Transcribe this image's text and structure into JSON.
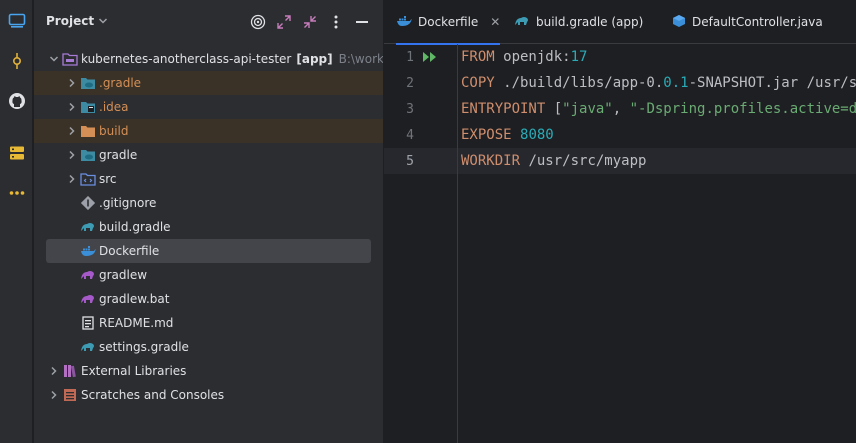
{
  "project_panel": {
    "title": "Project",
    "root": {
      "name": "kubernetes-anotherclass-api-tester",
      "module": "[app]",
      "path": "B:\\workspace"
    },
    "items": [
      {
        "label": ".gradle",
        "icon": "folder-gradle-icon",
        "expandable": true,
        "ignored": true
      },
      {
        "label": ".idea",
        "icon": "folder-idea-icon",
        "expandable": true,
        "ignored": false
      },
      {
        "label": "build",
        "icon": "folder-excluded-icon",
        "expandable": true,
        "ignored": true
      },
      {
        "label": "gradle",
        "icon": "folder-gradle-icon",
        "expandable": true,
        "ignored": false
      },
      {
        "label": "src",
        "icon": "folder-source-icon",
        "expandable": true,
        "ignored": false
      },
      {
        "label": ".gitignore",
        "icon": "gitignore-icon",
        "expandable": false
      },
      {
        "label": "build.gradle",
        "icon": "gradle-file-icon",
        "expandable": false
      },
      {
        "label": "Dockerfile",
        "icon": "docker-icon",
        "expandable": false,
        "selected": true
      },
      {
        "label": "gradlew",
        "icon": "gradlew-icon",
        "expandable": false
      },
      {
        "label": "gradlew.bat",
        "icon": "gradlew-icon",
        "expandable": false
      },
      {
        "label": "README.md",
        "icon": "markdown-icon",
        "expandable": false
      },
      {
        "label": "settings.gradle",
        "icon": "gradle-file-icon",
        "expandable": false
      }
    ],
    "external_libraries": "External Libraries",
    "scratches": "Scratches and Consoles"
  },
  "tabs": [
    {
      "label": "Dockerfile",
      "active": true
    },
    {
      "label": "build.gradle (app)",
      "active": false
    },
    {
      "label": "DefaultController.java",
      "active": false
    }
  ],
  "editor": {
    "lines": [
      {
        "n": "1",
        "tokens": [
          [
            "kw",
            "FROM"
          ],
          [
            "plain",
            " openjdk:"
          ],
          [
            "num",
            "17"
          ]
        ]
      },
      {
        "n": "2",
        "tokens": [
          [
            "kw",
            "COPY"
          ],
          [
            "plain",
            " ./build/libs/app-0."
          ],
          [
            "num",
            "0.1"
          ],
          [
            "plain",
            "-SNAPSHOT.jar /usr/src/myapp/app.jar"
          ]
        ]
      },
      {
        "n": "3",
        "tokens": [
          [
            "kw",
            "ENTRYPOINT"
          ],
          [
            "plain",
            " ["
          ],
          [
            "str",
            "\"java\""
          ],
          [
            "plain",
            ", "
          ],
          [
            "str",
            "\"-Dspring.profiles.active=dev\""
          ],
          [
            "plain",
            "]"
          ]
        ]
      },
      {
        "n": "4",
        "tokens": [
          [
            "kw",
            "EXPOSE"
          ],
          [
            "plain",
            " "
          ],
          [
            "num",
            "8080"
          ]
        ]
      },
      {
        "n": "5",
        "tokens": [
          [
            "kw",
            "WORKDIR"
          ],
          [
            "plain",
            " /usr/src/myapp"
          ]
        ]
      }
    ],
    "current_line": "5"
  },
  "colors": {
    "accent": "#3574f0",
    "keyword": "#cf8e6d",
    "number": "#2aacb8",
    "string": "#6aab73",
    "ignored_text": "#d48f56"
  }
}
